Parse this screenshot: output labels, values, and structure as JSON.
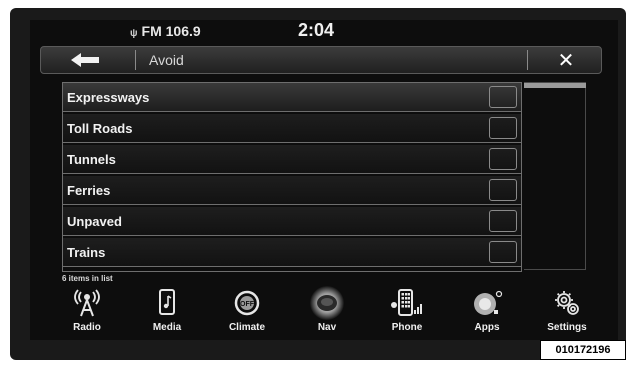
{
  "status": {
    "radio_text": "FM 106.9",
    "time": "2:04"
  },
  "header": {
    "title": "Avoid",
    "back_icon": "left-arrow-icon",
    "close_label": "✕"
  },
  "list": {
    "items": [
      {
        "label": "Expressways",
        "checked": false
      },
      {
        "label": "Toll Roads",
        "checked": false
      },
      {
        "label": "Tunnels",
        "checked": false
      },
      {
        "label": "Ferries",
        "checked": false
      },
      {
        "label": "Unpaved",
        "checked": false
      },
      {
        "label": "Trains",
        "checked": false
      }
    ],
    "count_text": "6 items in list"
  },
  "dock": {
    "items": [
      {
        "label": "Radio",
        "icon": "antenna-icon"
      },
      {
        "label": "Media",
        "icon": "media-icon"
      },
      {
        "label": "Climate",
        "icon": "climate-icon"
      },
      {
        "label": "Nav",
        "icon": "nav-icon",
        "active": true
      },
      {
        "label": "Phone",
        "icon": "phone-icon"
      },
      {
        "label": "Apps",
        "icon": "apps-icon"
      },
      {
        "label": "Settings",
        "icon": "settings-icon"
      }
    ]
  },
  "reference_code": "010172196"
}
